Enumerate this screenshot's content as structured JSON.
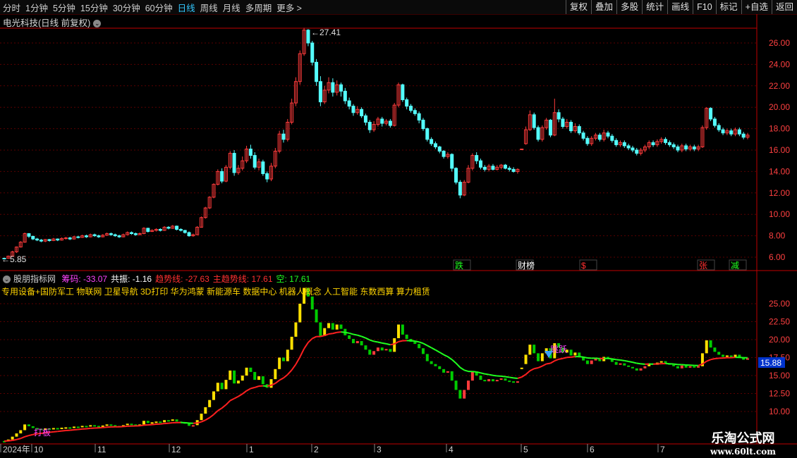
{
  "toolbar": {
    "periods": [
      "分时",
      "1分钟",
      "5分钟",
      "15分钟",
      "30分钟",
      "60分钟",
      "日线",
      "周线",
      "月线",
      "多周期",
      "更多 >"
    ],
    "active_period": "日线",
    "actions": [
      "复权",
      "叠加",
      "多股",
      "统计",
      "画线",
      "F10",
      "标记",
      "+自选",
      "返回"
    ]
  },
  "stock_title": "电光科技(日线 前复权)",
  "colors": {
    "up": "#ff3b3b",
    "down": "#54ffff",
    "grid": "#5a0000",
    "axis": "#c00000",
    "trend_up": "#ff2020",
    "trend_down": "#20ff20",
    "yellow": "#ffe000",
    "green": "#00cc00",
    "magenta": "#ff44ff"
  },
  "price_axis": {
    "ticks": [
      "26.00",
      "24.00",
      "22.00",
      "20.00",
      "18.00",
      "16.00",
      "14.00",
      "12.00",
      "10.00",
      "8.00",
      "6.00"
    ]
  },
  "price_marks": {
    "high": "27.41",
    "low": "5.85"
  },
  "event_tags": [
    "跌",
    "财榜",
    "$",
    "张",
    "减"
  ],
  "indicator": {
    "name": "股朋指标网",
    "items": [
      {
        "label": "筹码:",
        "value": "-33.07",
        "color": "#ff44ff"
      },
      {
        "label": "共振:",
        "value": "-1.16",
        "color": "#ffffff"
      },
      {
        "label": "趋势线:",
        "value": "-27.63",
        "color": "#ff3030"
      },
      {
        "label": "主趋势线:",
        "value": "17.61",
        "color": "#ff3030"
      },
      {
        "label": "空:",
        "value": "17.61",
        "color": "#20ff20"
      }
    ],
    "axis_ticks": [
      "25.00",
      "22.50",
      "20.00",
      "17.50",
      "15.00",
      "12.50",
      "10.00"
    ],
    "current_value": "15.88",
    "concepts": "专用设备+国防军工 物联网 卫星导航 3D打印 华为鸿蒙 新能源车 数据中心 机器人概念 人工智能 东数西算 算力租赁",
    "signal_labels": [
      "打板",
      "跳跃"
    ]
  },
  "date_axis": {
    "labels": [
      "2024年",
      "10",
      "11",
      "12",
      "1",
      "2",
      "3",
      "4",
      "5",
      "6",
      "7"
    ]
  },
  "watermark": {
    "line1": "乐淘公式网",
    "line2": "www.60lt.com"
  },
  "candles": [
    [
      5.9,
      5.88,
      5.95,
      5.8
    ],
    [
      5.9,
      6.1,
      6.15,
      5.88
    ],
    [
      6.1,
      6.5,
      6.6,
      6.05
    ],
    [
      6.5,
      6.95,
      7.0,
      6.4
    ],
    [
      6.95,
      7.4,
      7.5,
      6.9
    ],
    [
      7.4,
      8.2,
      8.3,
      7.35
    ],
    [
      8.2,
      7.95,
      8.25,
      7.8
    ],
    [
      7.95,
      7.7,
      8.0,
      7.6
    ],
    [
      7.7,
      7.6,
      7.8,
      7.5
    ],
    [
      7.6,
      7.5,
      7.7,
      7.4
    ],
    [
      7.5,
      7.65,
      7.7,
      7.4
    ],
    [
      7.65,
      7.55,
      7.7,
      7.45
    ],
    [
      7.55,
      7.7,
      7.8,
      7.5
    ],
    [
      7.7,
      7.6,
      7.75,
      7.5
    ],
    [
      7.6,
      7.75,
      7.85,
      7.55
    ],
    [
      7.75,
      7.8,
      7.9,
      7.65
    ],
    [
      7.8,
      7.7,
      7.9,
      7.6
    ],
    [
      7.7,
      7.9,
      8.0,
      7.65
    ],
    [
      7.9,
      7.85,
      8.0,
      7.75
    ],
    [
      7.85,
      8.0,
      8.1,
      7.8
    ],
    [
      8.0,
      7.9,
      8.1,
      7.8
    ],
    [
      7.9,
      8.1,
      8.2,
      7.85
    ],
    [
      8.1,
      8.0,
      8.2,
      7.9
    ],
    [
      8.0,
      7.9,
      8.1,
      7.8
    ],
    [
      7.9,
      8.05,
      8.15,
      7.85
    ],
    [
      8.05,
      8.2,
      8.3,
      8.0
    ],
    [
      8.2,
      8.1,
      8.3,
      8.0
    ],
    [
      8.1,
      8.0,
      8.2,
      7.9
    ],
    [
      8.0,
      7.9,
      8.1,
      7.8
    ],
    [
      7.9,
      8.1,
      8.2,
      7.85
    ],
    [
      8.1,
      8.3,
      8.4,
      8.05
    ],
    [
      8.3,
      8.2,
      8.4,
      8.1
    ],
    [
      8.2,
      8.1,
      8.3,
      8.0
    ],
    [
      8.1,
      8.2,
      8.3,
      8.05
    ],
    [
      8.2,
      8.7,
      8.8,
      8.15
    ],
    [
      8.7,
      8.4,
      8.75,
      8.3
    ],
    [
      8.4,
      8.5,
      8.6,
      8.35
    ],
    [
      8.5,
      8.6,
      8.7,
      8.4
    ],
    [
      8.6,
      8.5,
      8.7,
      8.4
    ],
    [
      8.5,
      8.8,
      8.9,
      8.45
    ],
    [
      8.8,
      8.7,
      8.9,
      8.6
    ],
    [
      8.7,
      8.9,
      9.0,
      8.65
    ],
    [
      8.9,
      8.6,
      8.95,
      8.5
    ],
    [
      8.6,
      8.5,
      8.7,
      8.4
    ],
    [
      8.5,
      8.3,
      8.55,
      8.2
    ],
    [
      8.3,
      8.0,
      8.4,
      7.9
    ],
    [
      8.0,
      8.1,
      8.2,
      7.9
    ],
    [
      8.1,
      8.8,
      8.9,
      8.05
    ],
    [
      8.8,
      9.7,
      9.8,
      8.75
    ],
    [
      9.7,
      10.6,
      10.7,
      9.6
    ],
    [
      10.6,
      11.6,
      11.7,
      10.5
    ],
    [
      11.6,
      12.8,
      12.9,
      11.5
    ],
    [
      12.8,
      14.0,
      14.2,
      12.7
    ],
    [
      14.0,
      13.1,
      14.3,
      12.9
    ],
    [
      13.1,
      14.4,
      14.6,
      13.0
    ],
    [
      14.4,
      15.7,
      15.9,
      14.2
    ],
    [
      15.7,
      13.9,
      16.0,
      13.6
    ],
    [
      13.9,
      14.3,
      14.6,
      13.7
    ],
    [
      14.3,
      15.0,
      15.4,
      14.1
    ],
    [
      15.0,
      16.1,
      16.4,
      14.8
    ],
    [
      16.1,
      15.5,
      16.5,
      15.2
    ],
    [
      15.5,
      14.4,
      15.8,
      14.2
    ],
    [
      14.4,
      14.9,
      15.2,
      14.1
    ],
    [
      14.9,
      13.8,
      15.1,
      13.6
    ],
    [
      13.8,
      13.3,
      14.0,
      13.0
    ],
    [
      13.3,
      14.5,
      14.8,
      13.1
    ],
    [
      14.5,
      15.9,
      16.2,
      14.3
    ],
    [
      15.9,
      17.5,
      17.8,
      15.7
    ],
    [
      17.5,
      17.0,
      17.9,
      16.7
    ],
    [
      17.0,
      18.6,
      18.9,
      16.8
    ],
    [
      18.6,
      20.4,
      20.8,
      18.4
    ],
    [
      20.4,
      22.4,
      22.8,
      20.1
    ],
    [
      22.4,
      25.0,
      25.3,
      22.1
    ],
    [
      25.0,
      27.2,
      27.41,
      24.8
    ],
    [
      27.2,
      26.0,
      27.3,
      25.7
    ],
    [
      26.0,
      24.2,
      26.2,
      23.9
    ],
    [
      24.2,
      22.4,
      24.5,
      22.0
    ],
    [
      22.4,
      20.5,
      22.9,
      20.1
    ],
    [
      20.5,
      21.6,
      22.0,
      20.3
    ],
    [
      21.6,
      22.3,
      22.8,
      21.3
    ],
    [
      22.3,
      21.4,
      22.7,
      21.0
    ],
    [
      21.4,
      22.1,
      22.5,
      21.1
    ],
    [
      22.1,
      21.5,
      22.3,
      21.0
    ],
    [
      21.5,
      20.6,
      21.8,
      20.3
    ],
    [
      20.6,
      20.1,
      20.9,
      19.8
    ],
    [
      20.1,
      19.5,
      20.3,
      19.2
    ],
    [
      19.5,
      19.8,
      20.1,
      19.3
    ],
    [
      19.8,
      19.2,
      20.0,
      19.0
    ],
    [
      19.2,
      18.6,
      19.4,
      18.3
    ],
    [
      18.6,
      17.9,
      18.8,
      17.6
    ],
    [
      17.9,
      18.4,
      18.7,
      17.7
    ],
    [
      18.4,
      18.9,
      19.1,
      18.2
    ],
    [
      18.9,
      18.5,
      19.1,
      18.2
    ],
    [
      18.5,
      18.7,
      18.9,
      18.3
    ],
    [
      18.7,
      18.3,
      18.9,
      18.1
    ],
    [
      18.3,
      20.2,
      20.4,
      18.2
    ],
    [
      20.2,
      22.1,
      22.3,
      20.0
    ],
    [
      22.1,
      20.7,
      22.2,
      20.5
    ],
    [
      20.7,
      20.1,
      20.9,
      19.8
    ],
    [
      20.1,
      19.7,
      20.3,
      19.5
    ],
    [
      19.7,
      19.4,
      19.9,
      19.2
    ],
    [
      19.4,
      18.8,
      19.6,
      18.5
    ],
    [
      18.8,
      18.0,
      19.0,
      17.8
    ],
    [
      18.0,
      17.0,
      18.1,
      16.8
    ],
    [
      17.0,
      16.6,
      17.2,
      16.4
    ],
    [
      16.6,
      16.3,
      16.8,
      16.1
    ],
    [
      16.3,
      15.9,
      16.4,
      15.7
    ],
    [
      15.9,
      15.4,
      16.0,
      15.2
    ],
    [
      15.4,
      15.6,
      15.8,
      15.2
    ],
    [
      15.6,
      14.3,
      15.7,
      14.0
    ],
    [
      14.3,
      13.0,
      14.4,
      12.8
    ],
    [
      13.0,
      11.8,
      13.2,
      11.5
    ],
    [
      11.8,
      13.0,
      13.2,
      11.7
    ],
    [
      13.0,
      14.3,
      14.6,
      12.9
    ],
    [
      14.3,
      15.5,
      15.7,
      14.1
    ],
    [
      15.5,
      15.0,
      15.8,
      14.7
    ],
    [
      15.0,
      14.4,
      15.2,
      14.2
    ],
    [
      14.4,
      14.2,
      14.6,
      14.0
    ],
    [
      14.2,
      14.5,
      14.7,
      14.0
    ],
    [
      14.5,
      14.2,
      14.7,
      14.1
    ],
    [
      14.2,
      14.4,
      14.6,
      14.1
    ],
    [
      14.4,
      14.6,
      14.7,
      14.2
    ],
    [
      14.6,
      14.3,
      14.7,
      14.2
    ],
    [
      14.3,
      14.2,
      14.5,
      14.0
    ],
    [
      14.2,
      14.0,
      14.4,
      13.9
    ],
    [
      14.0,
      14.2,
      14.3,
      13.8
    ],
    [
      16.1,
      16.1,
      16.1,
      16.1
    ],
    [
      16.6,
      17.9,
      18.2,
      16.5
    ],
    [
      17.9,
      19.3,
      19.7,
      17.8
    ],
    [
      19.3,
      18.1,
      19.5,
      17.9
    ],
    [
      18.1,
      17.0,
      18.3,
      16.8
    ],
    [
      17.0,
      18.1,
      18.3,
      16.8
    ],
    [
      18.1,
      18.8,
      19.0,
      17.9
    ],
    [
      18.8,
      17.4,
      18.9,
      17.2
    ],
    [
      17.4,
      19.5,
      20.8,
      17.3
    ],
    [
      19.5,
      18.9,
      19.8,
      18.6
    ],
    [
      18.9,
      18.2,
      19.1,
      18.0
    ],
    [
      18.2,
      18.6,
      18.9,
      18.0
    ],
    [
      18.6,
      17.8,
      18.8,
      17.6
    ],
    [
      17.8,
      18.2,
      18.5,
      17.6
    ],
    [
      18.2,
      17.6,
      18.4,
      17.4
    ],
    [
      17.6,
      17.1,
      17.8,
      16.9
    ],
    [
      17.1,
      16.6,
      17.3,
      16.4
    ],
    [
      16.6,
      17.1,
      17.3,
      16.4
    ],
    [
      17.1,
      17.4,
      17.6,
      16.9
    ],
    [
      17.4,
      17.0,
      17.6,
      16.8
    ],
    [
      17.0,
      17.6,
      17.9,
      16.8
    ],
    [
      17.6,
      17.3,
      17.8,
      17.1
    ],
    [
      17.3,
      16.9,
      17.5,
      16.7
    ],
    [
      16.9,
      16.5,
      17.1,
      16.3
    ],
    [
      16.5,
      16.7,
      16.9,
      16.3
    ],
    [
      16.7,
      16.4,
      16.9,
      16.2
    ],
    [
      16.4,
      16.2,
      16.6,
      16.0
    ],
    [
      16.2,
      16.0,
      16.4,
      15.8
    ],
    [
      16.0,
      15.7,
      16.2,
      15.5
    ],
    [
      15.7,
      16.0,
      16.2,
      15.5
    ],
    [
      16.0,
      16.3,
      16.5,
      15.8
    ],
    [
      16.3,
      16.7,
      16.9,
      16.1
    ],
    [
      16.7,
      16.5,
      16.9,
      16.3
    ],
    [
      16.5,
      16.8,
      17.0,
      16.3
    ],
    [
      16.8,
      17.0,
      17.2,
      16.6
    ],
    [
      17.0,
      16.7,
      17.2,
      16.5
    ],
    [
      16.7,
      16.5,
      16.9,
      16.3
    ],
    [
      16.5,
      16.3,
      16.7,
      16.1
    ],
    [
      16.3,
      16.0,
      16.5,
      15.8
    ],
    [
      16.0,
      16.4,
      16.6,
      15.8
    ],
    [
      16.4,
      16.1,
      16.6,
      15.9
    ],
    [
      16.1,
      16.3,
      16.5,
      15.9
    ],
    [
      16.3,
      16.1,
      16.5,
      15.9
    ],
    [
      16.1,
      16.3,
      16.5,
      15.9
    ],
    [
      16.3,
      18.1,
      18.3,
      16.2
    ],
    [
      18.1,
      19.9,
      20.0,
      17.9
    ],
    [
      19.9,
      18.9,
      20.0,
      18.7
    ],
    [
      18.9,
      18.3,
      19.1,
      18.1
    ],
    [
      18.3,
      17.9,
      18.5,
      17.7
    ],
    [
      17.9,
      17.6,
      18.1,
      17.4
    ],
    [
      17.6,
      17.8,
      18.0,
      17.4
    ],
    [
      17.8,
      17.5,
      18.0,
      17.3
    ],
    [
      17.5,
      17.9,
      18.1,
      17.3
    ],
    [
      17.9,
      17.5,
      18.1,
      17.3
    ],
    [
      17.5,
      17.2,
      17.7,
      17.0
    ],
    [
      17.2,
      17.4,
      17.6,
      17.0
    ]
  ]
}
